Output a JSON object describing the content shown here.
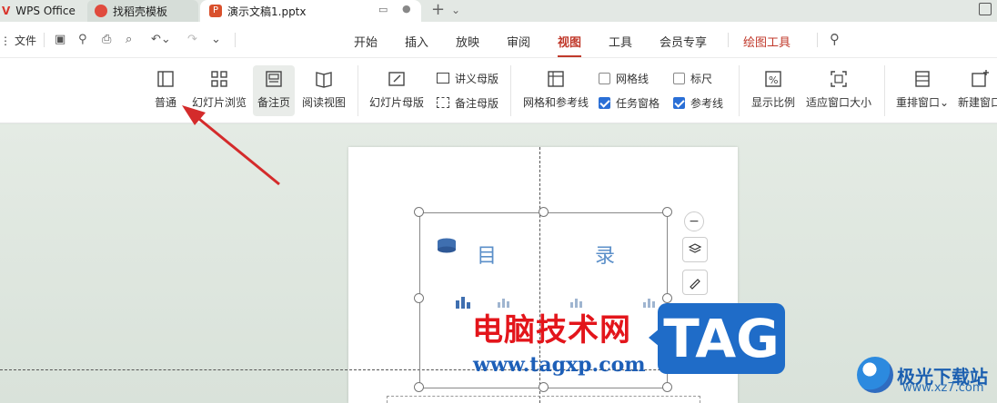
{
  "tabs": [
    {
      "label": "WPS Office"
    },
    {
      "label": "找稻壳模板"
    },
    {
      "label": "演示文稿1.pptx"
    }
  ],
  "menubar": {
    "file_label": "文件",
    "tabs": [
      "开始",
      "插入",
      "放映",
      "审阅",
      "视图",
      "工具",
      "会员专享",
      "绘图工具"
    ],
    "active_tab": "视图"
  },
  "ribbon": {
    "normal": "普通",
    "slide_sorter": "幻灯片浏览",
    "notes_page": "备注页",
    "reading_view": "阅读视图",
    "slide_master": "幻灯片母版",
    "handout_master": "讲义母版",
    "notes_master": "备注母版",
    "grid_guides": "网格和参考线",
    "gridlines": {
      "label": "网格线",
      "checked": false
    },
    "ruler": {
      "label": "标尺",
      "checked": false
    },
    "task_pane": {
      "label": "任务窗格",
      "checked": true
    },
    "guides": {
      "label": "参考线",
      "checked": true
    },
    "zoom": "显示比例",
    "fit_window": "适应窗口大小",
    "arrange": "重排窗口",
    "new_window": "新建窗口"
  },
  "slide": {
    "word_left": "目",
    "word_right": "录"
  },
  "watermark": {
    "cn": "电脑技术网",
    "url": "www.tagxp.com",
    "tag": "TAG",
    "brand_name": "极光下载站",
    "brand_url": "www.xz7.com"
  },
  "colors": {
    "accent": "#c0392b",
    "checkbox": "#2a6fd6",
    "arrow": "#d42b2b"
  }
}
